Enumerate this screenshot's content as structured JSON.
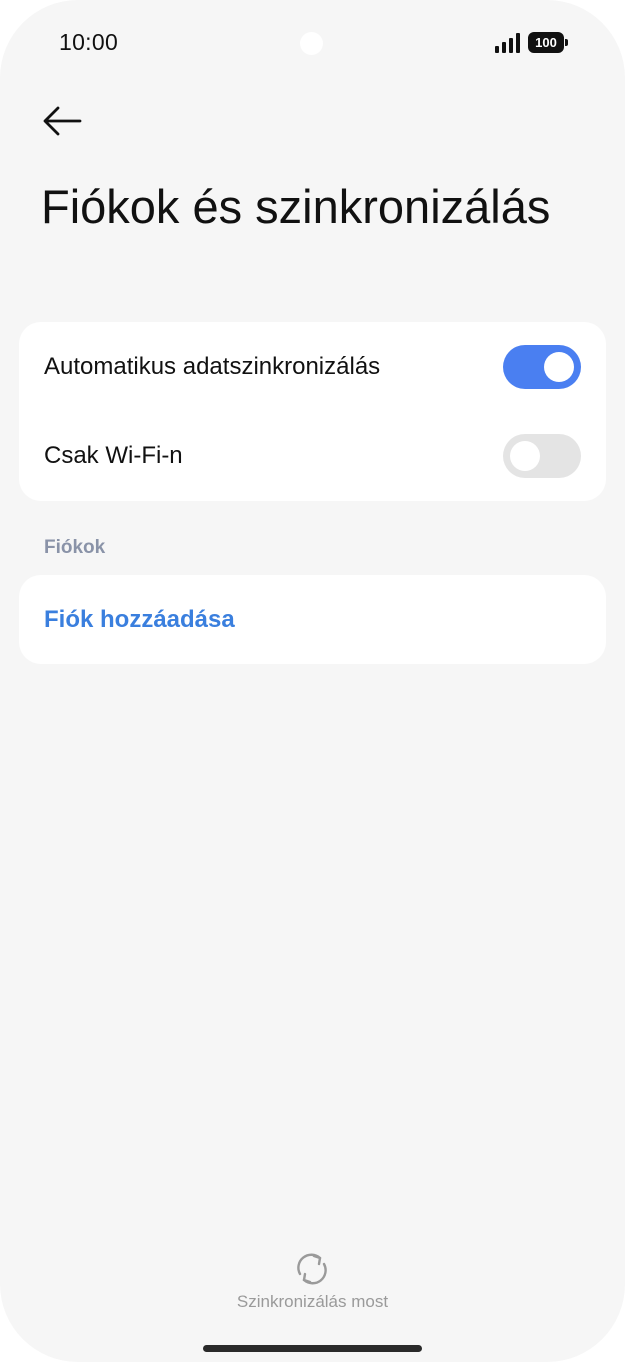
{
  "status_bar": {
    "time": "10:00",
    "battery": "100"
  },
  "header": {
    "back_icon": "arrow-left-icon",
    "title": "Fiókok és szinkronizálás"
  },
  "sync_settings": {
    "items": [
      {
        "label": "Automatikus adatszinkronizálás",
        "enabled": true,
        "accent": "#4a7ff1"
      },
      {
        "label": "Csak Wi-Fi-n",
        "enabled": false
      }
    ]
  },
  "accounts_section": {
    "header": "Fiókok",
    "add_label": "Fiók hozzáadása",
    "add_color": "#3a7fde"
  },
  "footer": {
    "sync_icon": "sync-icon",
    "sync_label": "Szinkronizálás most"
  }
}
